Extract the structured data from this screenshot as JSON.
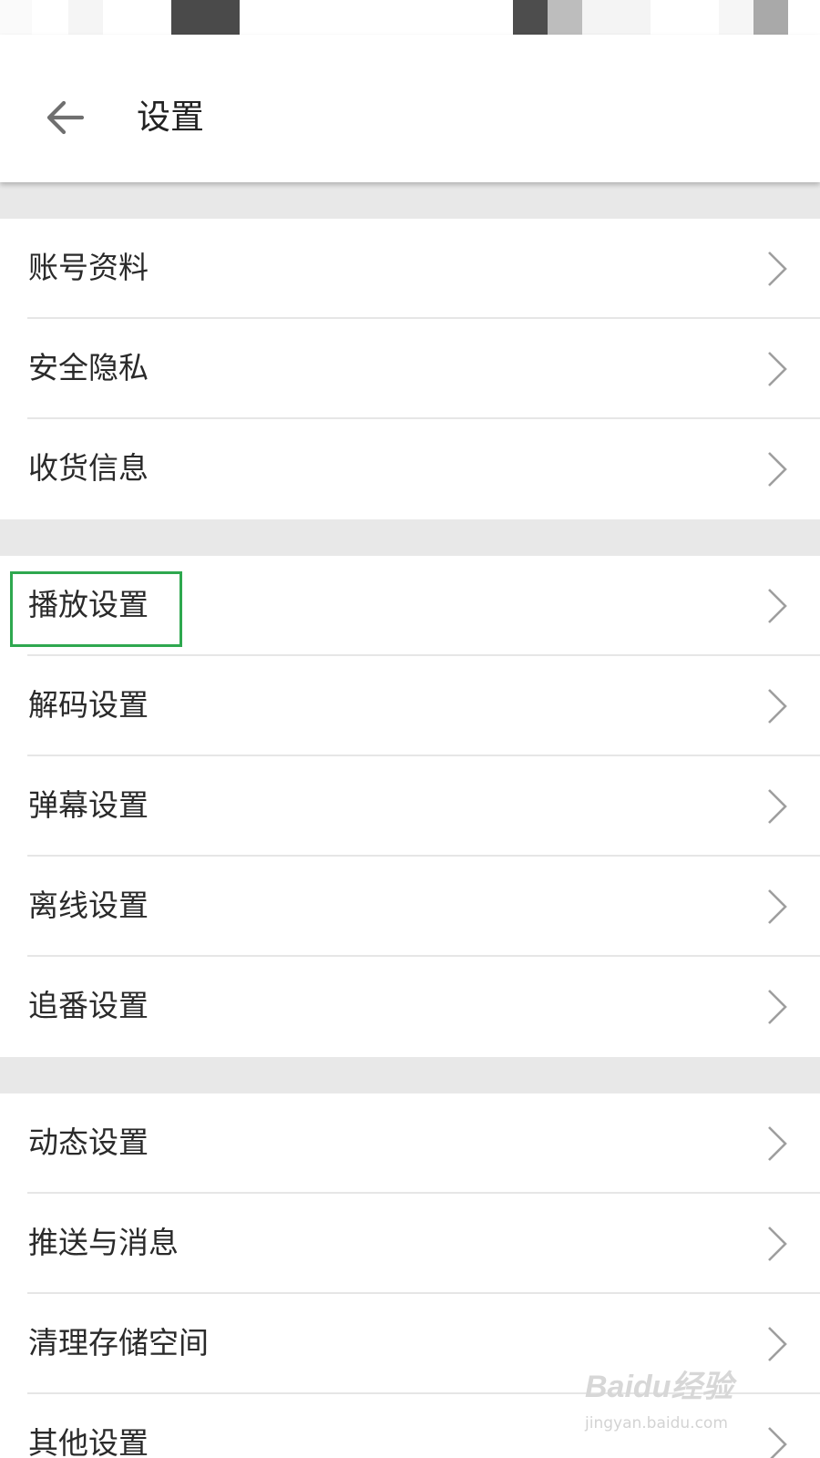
{
  "header": {
    "title": "设置"
  },
  "sections": [
    {
      "items": [
        {
          "label": "账号资料"
        },
        {
          "label": "安全隐私"
        },
        {
          "label": "收货信息"
        }
      ]
    },
    {
      "items": [
        {
          "label": "播放设置",
          "highlighted": true
        },
        {
          "label": "解码设置"
        },
        {
          "label": "弹幕设置"
        },
        {
          "label": "离线设置"
        },
        {
          "label": "追番设置"
        }
      ]
    },
    {
      "items": [
        {
          "label": "动态设置"
        },
        {
          "label": "推送与消息"
        },
        {
          "label": "清理存储空间"
        },
        {
          "label": "其他设置"
        }
      ]
    }
  ],
  "watermark": {
    "brand": "Baidu经验",
    "site": "jingyan.baidu.com"
  },
  "colors": {
    "highlight": "#2ea84f",
    "section_gap": "#e8e8e8",
    "divider": "#e6e6e6",
    "chevron": "#9e9e9e"
  }
}
